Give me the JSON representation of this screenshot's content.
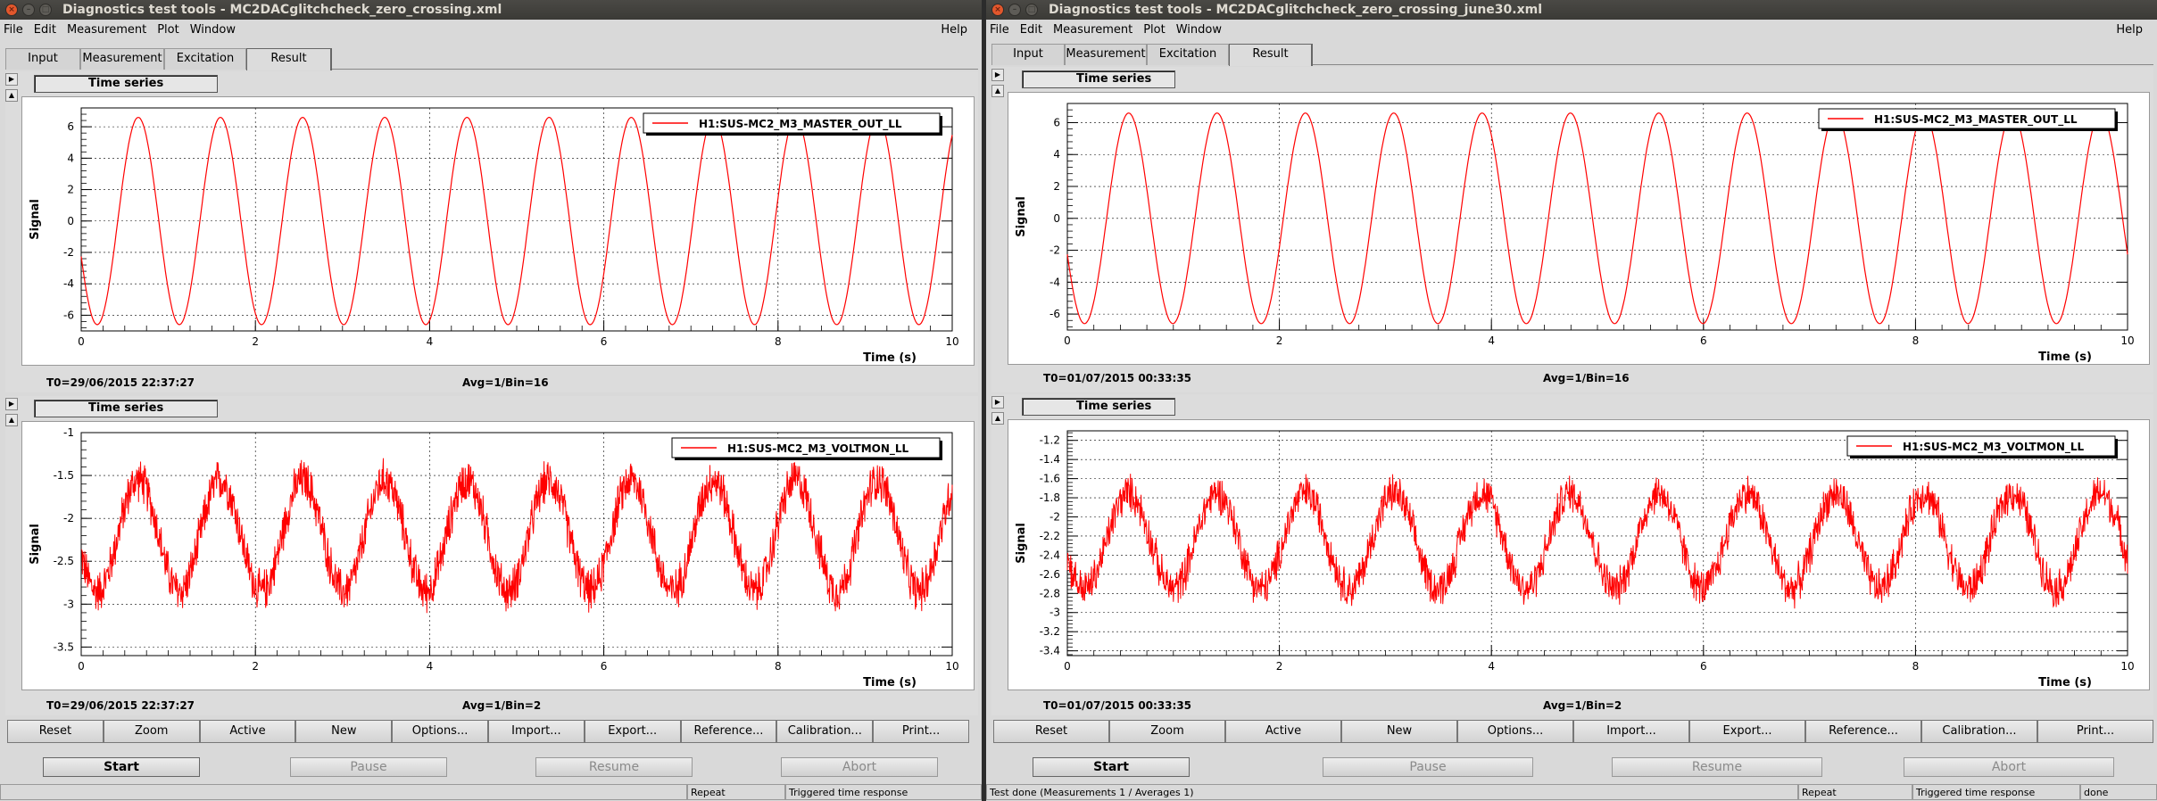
{
  "windows": [
    {
      "title": "Diagnostics test tools - MC2DACglitchcheck_zero_crossing.xml",
      "menu": [
        "File",
        "Edit",
        "Measurement",
        "Plot",
        "Window"
      ],
      "help": "Help",
      "tabs": [
        "Input",
        "Measurement",
        "Excitation",
        "Result"
      ],
      "active_tab": "Result",
      "plots": [
        {
          "panel_label": "Time series",
          "legend": "H1:SUS-MC2_M3_MASTER_OUT_LL",
          "t0": "T0=29/06/2015 22:37:27",
          "avg": "Avg=1/Bin=16",
          "xlabel": "Time (s)",
          "ylabel": "Signal",
          "x_ticks": [
            "0",
            "2",
            "4",
            "6",
            "8",
            "10"
          ],
          "y_ticks": [
            "6",
            "4",
            "2",
            "0",
            "-2",
            "-4",
            "-6"
          ]
        },
        {
          "panel_label": "Time series",
          "legend": "H1:SUS-MC2_M3_VOLTMON_LL",
          "t0": "T0=29/06/2015 22:37:27",
          "avg": "Avg=1/Bin=2",
          "xlabel": "Time (s)",
          "ylabel": "Signal",
          "x_ticks": [
            "0",
            "2",
            "4",
            "6",
            "8",
            "10"
          ],
          "y_ticks": [
            "-1",
            "-1.5",
            "-2",
            "-2.5",
            "-3",
            "-3.5"
          ]
        }
      ],
      "buttons": [
        "Reset",
        "Zoom",
        "Active",
        "New",
        "Options...",
        "Import...",
        "Export...",
        "Reference...",
        "Calibration...",
        "Print..."
      ],
      "controls": [
        "Start",
        "Pause",
        "Resume",
        "Abort"
      ],
      "status": [
        "",
        "Repeat",
        "Triggered time response"
      ]
    },
    {
      "title": "Diagnostics test tools - MC2DACglitchcheck_zero_crossing_june30.xml",
      "menu": [
        "File",
        "Edit",
        "Measurement",
        "Plot",
        "Window"
      ],
      "help": "Help",
      "tabs": [
        "Input",
        "Measurement",
        "Excitation",
        "Result"
      ],
      "active_tab": "Result",
      "plots": [
        {
          "panel_label": "Time series",
          "legend": "H1:SUS-MC2_M3_MASTER_OUT_LL",
          "t0": "T0=01/07/2015 00:33:35",
          "avg": "Avg=1/Bin=16",
          "xlabel": "Time (s)",
          "ylabel": "Signal",
          "x_ticks": [
            "0",
            "2",
            "4",
            "6",
            "8",
            "10"
          ],
          "y_ticks": [
            "6",
            "4",
            "2",
            "0",
            "-2",
            "-4",
            "-6"
          ]
        },
        {
          "panel_label": "Time series",
          "legend": "H1:SUS-MC2_M3_VOLTMON_LL",
          "t0": "T0=01/07/2015 00:33:35",
          "avg": "Avg=1/Bin=2",
          "xlabel": "Time (s)",
          "ylabel": "Signal",
          "x_ticks": [
            "0",
            "2",
            "4",
            "6",
            "8",
            "10"
          ],
          "y_ticks": [
            "-1.2",
            "-1.4",
            "-1.6",
            "-1.8",
            "-2",
            "-2.2",
            "-2.4",
            "-2.6",
            "-2.8",
            "-3",
            "-3.2",
            "-3.4"
          ]
        }
      ],
      "buttons": [
        "Reset",
        "Zoom",
        "Active",
        "New",
        "Options...",
        "Import...",
        "Export...",
        "Reference...",
        "Calibration...",
        "Print..."
      ],
      "controls": [
        "Start",
        "Pause",
        "Resume",
        "Abort"
      ],
      "status": [
        "Test done (Measurements 1 / Averages 1)",
        "Repeat",
        "Triggered time response",
        "done"
      ]
    }
  ],
  "chart_data": [
    {
      "type": "line",
      "title": "",
      "xlabel": "Time (s)",
      "ylabel": "Signal",
      "legend": "H1:SUS-MC2_M3_MASTER_OUT_LL",
      "xlim": [
        0,
        10
      ],
      "ylim": [
        -7,
        7.2
      ],
      "series": [
        {
          "name": "H1:SUS-MC2_M3_MASTER_OUT_LL",
          "shape": "sine",
          "amplitude": 6.6,
          "offset": 0,
          "frequency_hz": 1.06,
          "noise": 0,
          "phase_deg": 200
        }
      ],
      "color": "#ff0000",
      "grid": true
    },
    {
      "type": "line",
      "title": "",
      "xlabel": "Time (s)",
      "ylabel": "Signal",
      "legend": "H1:SUS-MC2_M3_VOLTMON_LL",
      "xlim": [
        0,
        10
      ],
      "ylim": [
        -3.6,
        -1
      ],
      "series": [
        {
          "name": "H1:SUS-MC2_M3_VOLTMON_LL",
          "shape": "noisy-sine",
          "amplitude": 0.65,
          "offset": -2.2,
          "frequency_hz": 1.06,
          "noise": 0.22,
          "phase_deg": 200
        }
      ],
      "color": "#ff0000",
      "grid": true
    },
    {
      "type": "line",
      "title": "",
      "xlabel": "Time (s)",
      "ylabel": "Signal",
      "legend": "H1:SUS-MC2_M3_MASTER_OUT_LL",
      "xlim": [
        0,
        10
      ],
      "ylim": [
        -7,
        7.2
      ],
      "series": [
        {
          "name": "H1:SUS-MC2_M3_MASTER_OUT_LL",
          "shape": "sine",
          "amplitude": 6.6,
          "offset": 0,
          "frequency_hz": 1.2,
          "noise": 0,
          "phase_deg": 200
        }
      ],
      "color": "#ff0000",
      "grid": true
    },
    {
      "type": "line",
      "title": "",
      "xlabel": "Time (s)",
      "ylabel": "Signal",
      "legend": "H1:SUS-MC2_M3_VOLTMON_LL",
      "xlim": [
        0,
        10
      ],
      "ylim": [
        -3.45,
        -1.1
      ],
      "series": [
        {
          "name": "H1:SUS-MC2_M3_VOLTMON_LL",
          "shape": "noisy-sine",
          "amplitude": 0.5,
          "offset": -2.25,
          "frequency_hz": 1.2,
          "noise": 0.18,
          "phase_deg": 200
        }
      ],
      "color": "#ff0000",
      "grid": true
    }
  ]
}
